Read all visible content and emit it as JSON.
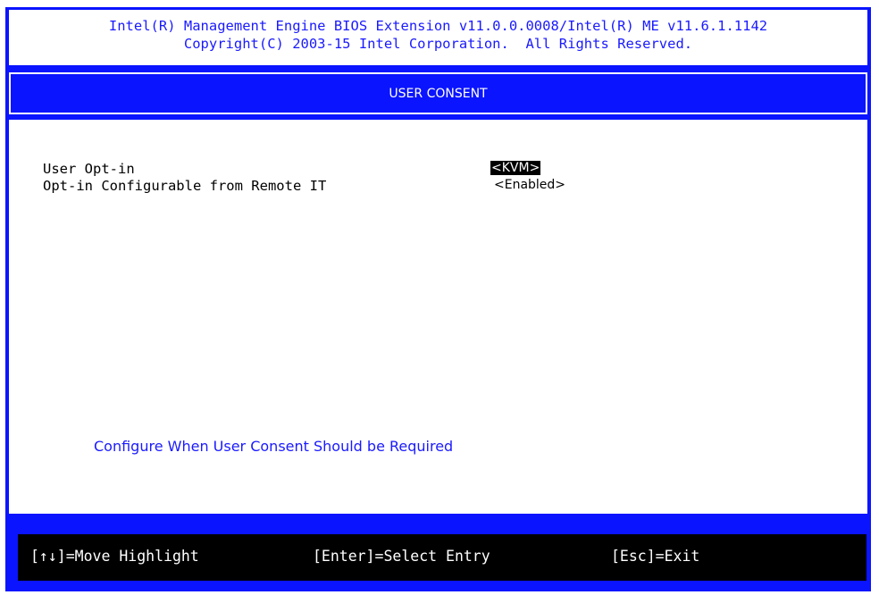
{
  "header": {
    "line1": "Intel(R) Management Engine BIOS Extension v11.0.0.0008/Intel(R) ME v11.6.1.1142",
    "line2": "Copyright(C) 2003-15 Intel Corporation.  All Rights Reserved."
  },
  "title": "USER CONSENT",
  "items": [
    {
      "label": "User Opt-in",
      "value": "<KVM>",
      "selected": true
    },
    {
      "label": "Opt-in Configurable from Remote IT",
      "value": "<Enabled>",
      "selected": false
    }
  ],
  "help_text": "Configure When User Consent Should be Required",
  "footer": {
    "move": "[↑↓]=Move Highlight",
    "select": "[Enter]=Select Entry",
    "exit": "[Esc]=Exit"
  },
  "colors": {
    "background_blue": "#0a14ff",
    "text_blue": "#1a1aff",
    "panel_white": "#ffffff",
    "footer_black": "#000000"
  }
}
